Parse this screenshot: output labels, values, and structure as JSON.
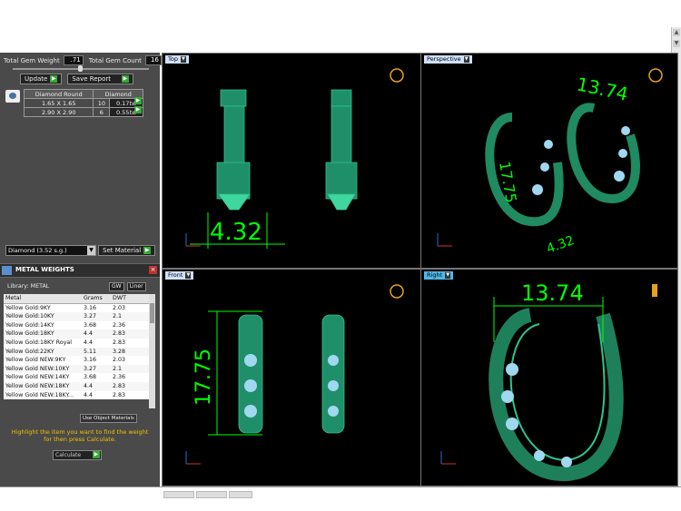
{
  "gem_panel": {
    "total_gem_weight_label": "Total Gem Weight",
    "total_gem_weight_value": ".71",
    "total_gem_count_label": "Total Gem Count",
    "total_gem_count_value": "16",
    "update_label": "Update",
    "save_report_label": "Save Report",
    "table_headers": [
      "Diamond Round",
      "Diamond"
    ],
    "rows": [
      {
        "size": "1.65 X 1.65",
        "count": "10",
        "weight": "0.17tw"
      },
      {
        "size": "2.90 X 2.90",
        "count": "6",
        "weight": "0.55tw"
      }
    ],
    "material_select": "Diamond   (3.52 s.g.)",
    "set_material_label": "Set Material"
  },
  "metal_weights": {
    "title": "METAL WEIGHTS",
    "library_label": "Library: METAL",
    "gw_label": "GW",
    "liner_label": "Liner",
    "headers": [
      "Metal",
      "Grams",
      "DWT"
    ],
    "rows": [
      [
        "Yellow Gold:9KY",
        "3.16",
        "2.03"
      ],
      [
        "Yellow Gold:10KY",
        "3.27",
        "2.1"
      ],
      [
        "Yellow Gold:14KY",
        "3.68",
        "2.36"
      ],
      [
        "Yellow Gold:18KY",
        "4.4",
        "2.83"
      ],
      [
        "Yellow Gold:18KY Royal",
        "4.4",
        "2.83"
      ],
      [
        "Yellow Gold:22KY",
        "5.11",
        "3.28"
      ],
      [
        "Yellow Gold NEW:9KY",
        "3.16",
        "2.03"
      ],
      [
        "Yellow Gold NEW:10KY",
        "3.27",
        "2.1"
      ],
      [
        "Yellow Gold NEW:14KY",
        "3.68",
        "2.36"
      ],
      [
        "Yellow Gold NEW:18KY",
        "4.4",
        "2.83"
      ],
      [
        "Yellow Gold NEW:18KY...",
        "4.4",
        "2.83"
      ]
    ],
    "use_object_label": "Use Object Materials",
    "hint": "Highlight the item you want to find the weight for then press Calculate.",
    "calculate_label": "Calculate"
  },
  "viewports": {
    "top": {
      "label": "Top",
      "dim": "4.32"
    },
    "perspective": {
      "label": "Perspective",
      "dim_a": "13.74",
      "dim_b": "17.75",
      "dim_c": "4.32"
    },
    "front": {
      "label": "Front",
      "dim": "17.75"
    },
    "right": {
      "label": "Right",
      "dim": "13.74"
    }
  },
  "colors": {
    "mesh": "#2ec48a",
    "dims": "#00ff00",
    "axis_x": "#cc3333",
    "axis_y": "#3366cc",
    "gem": "#a0d8f0"
  }
}
